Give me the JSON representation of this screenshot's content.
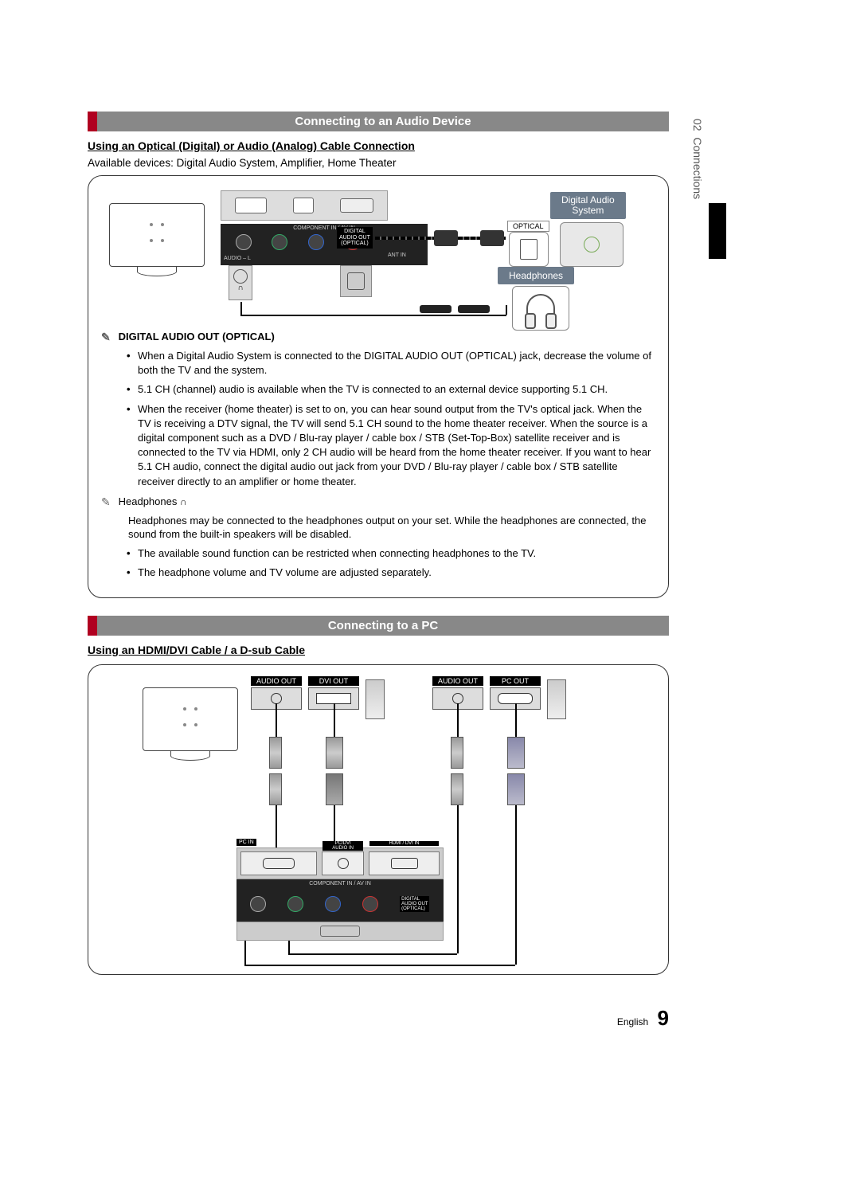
{
  "sideTab": {
    "chapter": "02",
    "title": "Connections"
  },
  "section1": {
    "header": "Connecting to an Audio Device",
    "subheading": "Using an Optical (Digital) or Audio (Analog) Cable Connection",
    "available": "Available devices: Digital Audio System, Amplifier, Home Theater",
    "diagram": {
      "digitalAudioSystem": "Digital Audio\nSystem",
      "optical": "OPTICAL",
      "headphones": "Headphones",
      "componentLabel": "COMPONENT IN / AV IN",
      "digAudioOut": "DIGITAL\nAUDIO OUT\n(OPTICAL)",
      "antIn": "ANT IN",
      "audioLR": "AUDIO – L"
    },
    "note1": {
      "title": "DIGITAL AUDIO OUT (OPTICAL)",
      "bullets": [
        "When a Digital Audio System is connected to the DIGITAL AUDIO OUT (OPTICAL) jack, decrease the volume of both the TV and the system.",
        "5.1 CH (channel) audio is available when the TV is connected to an external device supporting 5.1 CH.",
        "When the receiver (home theater) is set to on, you can hear sound output from the TV's optical jack. When the TV is receiving a DTV signal, the TV will send 5.1 CH sound to the home theater receiver. When the source is a digital component such as a DVD / Blu-ray player / cable box / STB (Set-Top-Box) satellite receiver and is connected to the TV via HDMI, only 2 CH audio will be heard from the home theater receiver. If you want to hear 5.1 CH audio, connect the digital audio out jack from your DVD / Blu-ray player / cable box / STB satellite receiver directly to an amplifier or home theater."
      ]
    },
    "note2": {
      "title": "Headphones",
      "body": "Headphones may be connected to the headphones output on your set. While the headphones are connected, the sound from the built-in speakers will be disabled.",
      "bullets": [
        "The available sound function can be restricted when connecting headphones to the TV.",
        "The headphone volume and TV volume are adjusted separately."
      ]
    }
  },
  "section2": {
    "header": "Connecting to a PC",
    "subheading": "Using an HDMI/DVI Cable / a D-sub Cable",
    "ports": {
      "audioOut": "AUDIO OUT",
      "dviOut": "DVI OUT",
      "pcOut": "PC OUT",
      "pcIn": "PC IN",
      "pcDviAudioIn": "PC/DVI\nAUDIO IN",
      "hdmiDviIn": "HDMI / DVI IN",
      "componentLabel": "COMPONENT IN / AV IN",
      "digAudioOut": "DIGITAL\nAUDIO OUT\n(OPTICAL)"
    }
  },
  "footer": {
    "lang": "English",
    "page": "9"
  }
}
